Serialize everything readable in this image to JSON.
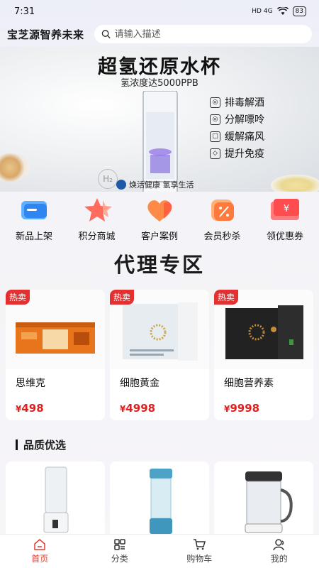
{
  "status": {
    "time": "7:31",
    "network": "HD 4G",
    "battery": "83"
  },
  "header": {
    "app_title": "宝芝源智养未来",
    "search_placeholder": "请输入描述"
  },
  "banner": {
    "title": "超氢还原水杯",
    "subtitle": "氢浓度达5000PPB",
    "features": [
      "排毒解酒",
      "分解嘌呤",
      "缓解痛风",
      "提升免疫"
    ],
    "brand": "焕活健康 氢享生活",
    "h2_mark": "H₂"
  },
  "categories": [
    {
      "label": "新品上架",
      "icon": "new-arrivals-icon"
    },
    {
      "label": "积分商城",
      "icon": "points-star-icon"
    },
    {
      "label": "客户案例",
      "icon": "heart-icon"
    },
    {
      "label": "会员秒杀",
      "icon": "flash-sale-icon"
    },
    {
      "label": "领优惠券",
      "icon": "coupon-icon"
    }
  ],
  "agent_section": {
    "title": "代理专区",
    "products": [
      {
        "badge": "热卖",
        "name": "思维克",
        "currency": "¥",
        "price": "498"
      },
      {
        "badge": "热卖",
        "name": "细胞黄金",
        "currency": "¥",
        "price": "4998"
      },
      {
        "badge": "热卖",
        "name": "细胞营养素",
        "currency": "¥",
        "price": "9998"
      }
    ]
  },
  "quality_section": {
    "title": "品质优选"
  },
  "tabbar": {
    "items": [
      {
        "label": "首页",
        "icon": "home-icon",
        "active": true
      },
      {
        "label": "分类",
        "icon": "category-icon",
        "active": false
      },
      {
        "label": "购物车",
        "icon": "cart-icon",
        "active": false
      },
      {
        "label": "我的",
        "icon": "profile-icon",
        "active": false
      }
    ]
  },
  "colors": {
    "accent": "#e23a2e",
    "price": "#e02020",
    "hot_badge": "#e33131"
  }
}
